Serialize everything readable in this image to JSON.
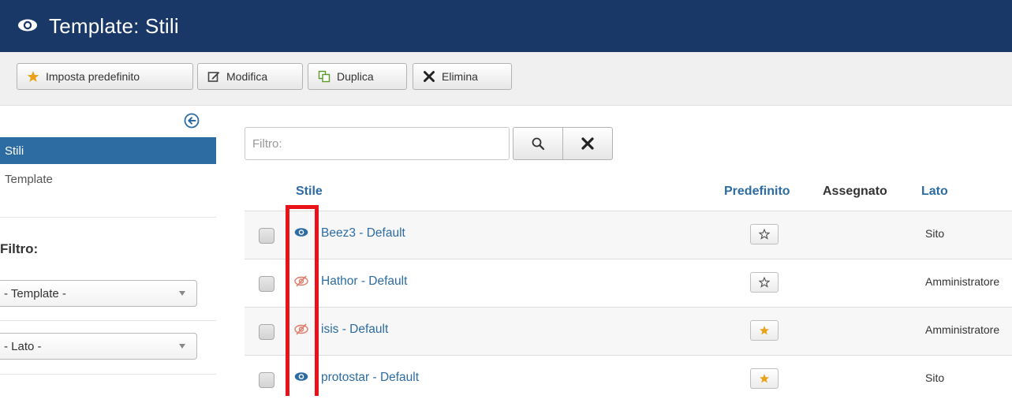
{
  "header": {
    "title": "Template: Stili",
    "icon": "eye-icon"
  },
  "toolbar": {
    "buttons": [
      {
        "label": "Imposta predefinito",
        "icon": "star-icon"
      },
      {
        "label": "Modifica",
        "icon": "edit-icon"
      },
      {
        "label": "Duplica",
        "icon": "copy-icon"
      },
      {
        "label": "Elimina",
        "icon": "close-icon"
      }
    ]
  },
  "sidebar": {
    "items": [
      {
        "label": "Stili",
        "active": true
      },
      {
        "label": "Template",
        "active": false
      }
    ],
    "filter_title": "Filtro:",
    "template_select": "- Template -",
    "side_select": "- Lato -"
  },
  "search": {
    "placeholder": "Filtro:"
  },
  "table": {
    "headers": {
      "style": "Stile",
      "default": "Predefinito",
      "assigned": "Assegnato",
      "side": "Lato"
    },
    "rows": [
      {
        "name": "Beez3 - Default",
        "enabled": true,
        "default": false,
        "side": "Sito"
      },
      {
        "name": "Hathor - Default",
        "enabled": false,
        "default": false,
        "side": "Amministratore"
      },
      {
        "name": "isis - Default",
        "enabled": false,
        "default": true,
        "side": "Amministratore"
      },
      {
        "name": "protostar - Default",
        "enabled": true,
        "default": true,
        "side": "Sito"
      }
    ]
  },
  "colors": {
    "header_bg": "#1a3867",
    "link": "#2d6ca2",
    "star_active": "#e8a31a",
    "hidden_icon": "#e07a6a",
    "highlight": "#e8131a"
  }
}
